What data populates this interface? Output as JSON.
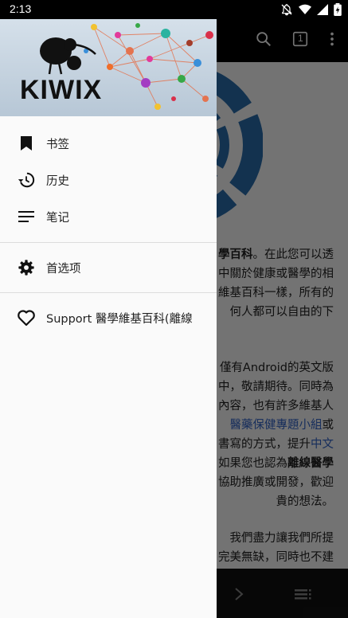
{
  "status_bar": {
    "time": "2:13",
    "icons": [
      "notifications-off-icon",
      "wifi-icon",
      "signal-icon",
      "battery-charging-icon"
    ]
  },
  "app_bar": {
    "tab_count": "1",
    "icons": [
      "search-icon",
      "tabs-icon",
      "more-vert-icon"
    ]
  },
  "drawer": {
    "brand": "KIWIX",
    "items": [
      {
        "label": "书签",
        "icon": "bookmark-icon"
      },
      {
        "label": "历史",
        "icon": "history-icon"
      },
      {
        "label": "笔记",
        "icon": "notes-icon"
      },
      {
        "label": "首选项",
        "icon": "settings-icon"
      },
      {
        "label": "Support 醫學維基百科(離線",
        "icon": "heart-icon"
      }
    ]
  },
  "content": {
    "lines": [
      {
        "pre": "",
        "bold": "學百科",
        "post": "。在此您可以透"
      },
      {
        "pre": "中關於健康或醫學的相",
        "bold": "",
        "post": ""
      },
      {
        "pre": "維基百科一樣，所有的",
        "bold": "",
        "post": ""
      },
      {
        "pre": "何人都可以自由的下",
        "bold": "",
        "post": ""
      },
      {
        "pre": "僅有Android的英文版",
        "bold": "",
        "post": ""
      },
      {
        "pre": "中，敬請期待。同時為",
        "bold": "",
        "post": ""
      },
      {
        "pre": "內容，也有許多維基人",
        "bold": "",
        "post": ""
      },
      {
        "link": "醫藥保健專題小組",
        "post": "或"
      },
      {
        "pre": "書寫的方式，提升",
        "link": "中文",
        "post": ""
      },
      {
        "pre": "如果您也認為",
        "bold": "離線醫學",
        "post": ""
      },
      {
        "pre": "協助推廣或開發，歡迎",
        "bold": "",
        "post": ""
      },
      {
        "pre": "貴的想法。",
        "bold": "",
        "post": ""
      },
      {
        "pre": "我們盡力讓我們所提",
        "bold": "",
        "post": ""
      },
      {
        "pre": "完美無缺，同時也不建",
        "bold": "",
        "post": ""
      }
    ]
  },
  "bottom_bar": {
    "icons": [
      "forward-icon",
      "toc-icon"
    ]
  },
  "colors": {
    "drawer_bg": "#fafafa",
    "link": "#3366cc",
    "logo_ring": "#2a6fb0"
  }
}
